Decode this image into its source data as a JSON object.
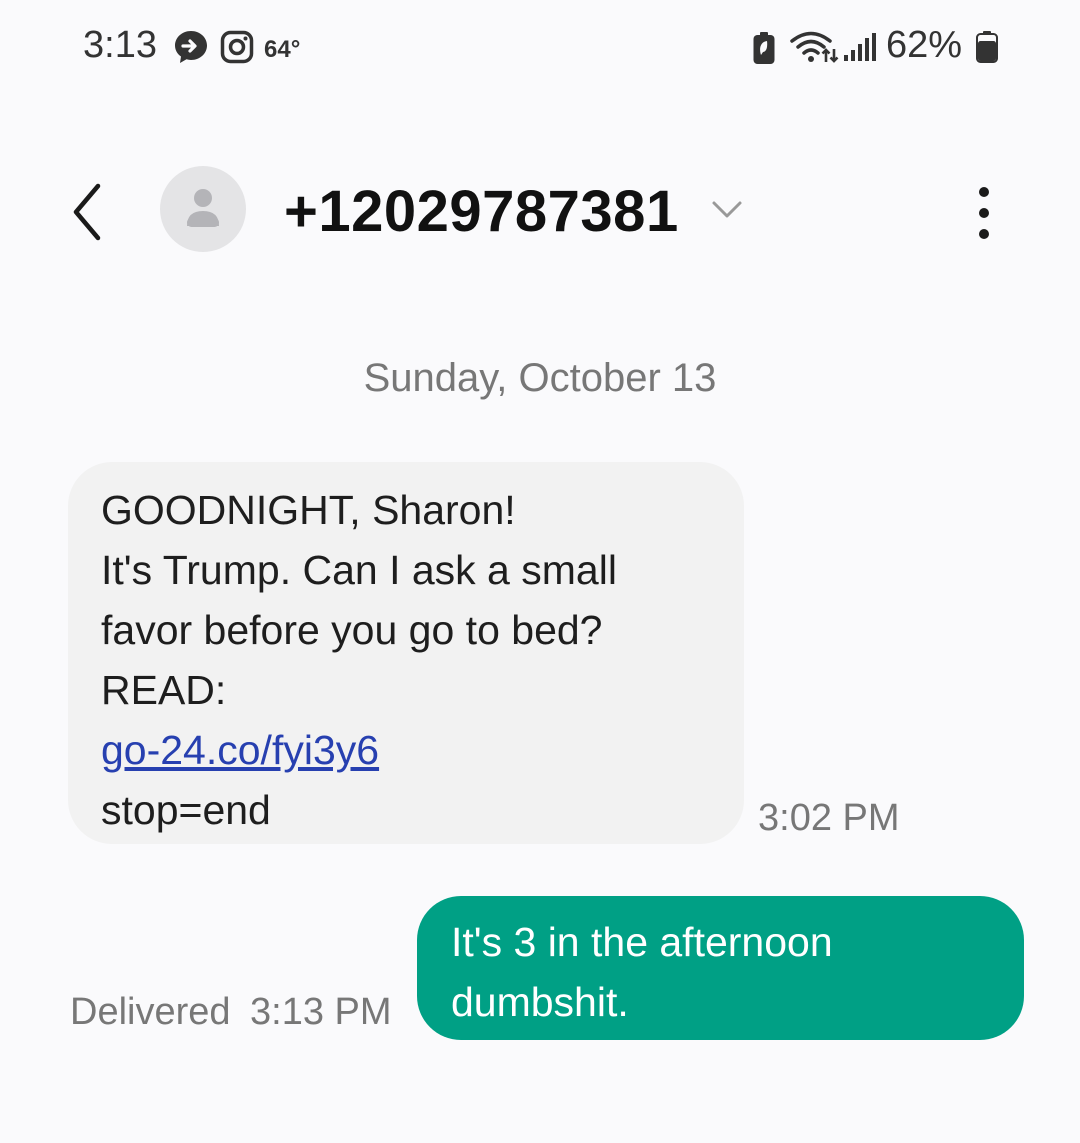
{
  "status_bar": {
    "time": "3:13",
    "temperature": "64°",
    "battery": "62%",
    "icons": [
      "messenger-icon",
      "instagram-icon",
      "battery-saver-icon",
      "wifi-icon",
      "signal-icon",
      "battery-icon"
    ]
  },
  "header": {
    "contact": "+12029787381",
    "icons": [
      "back-arrow-icon",
      "contact-avatar-icon",
      "chevron-down-icon",
      "more-vertical-icon"
    ]
  },
  "conversation": {
    "date": "Sunday, October 13",
    "messages": [
      {
        "direction": "incoming",
        "lines": [
          "GOODNIGHT, Sharon!",
          "It's Trump. Can I ask a small",
          "favor before you go to bed?",
          "READ:"
        ],
        "link": "go-24.co/fyi3y6",
        "last_line": "stop=end",
        "time": "3:02 PM"
      },
      {
        "direction": "outgoing",
        "lines": [
          "It's 3 in the afternoon",
          "dumbshit."
        ],
        "status": "Delivered",
        "time": "3:13 PM"
      }
    ]
  },
  "colors": {
    "background": "#fafafc",
    "incoming_bubble": "#f2f2f2",
    "outgoing_bubble": "#00a085",
    "link": "#2740b0"
  }
}
